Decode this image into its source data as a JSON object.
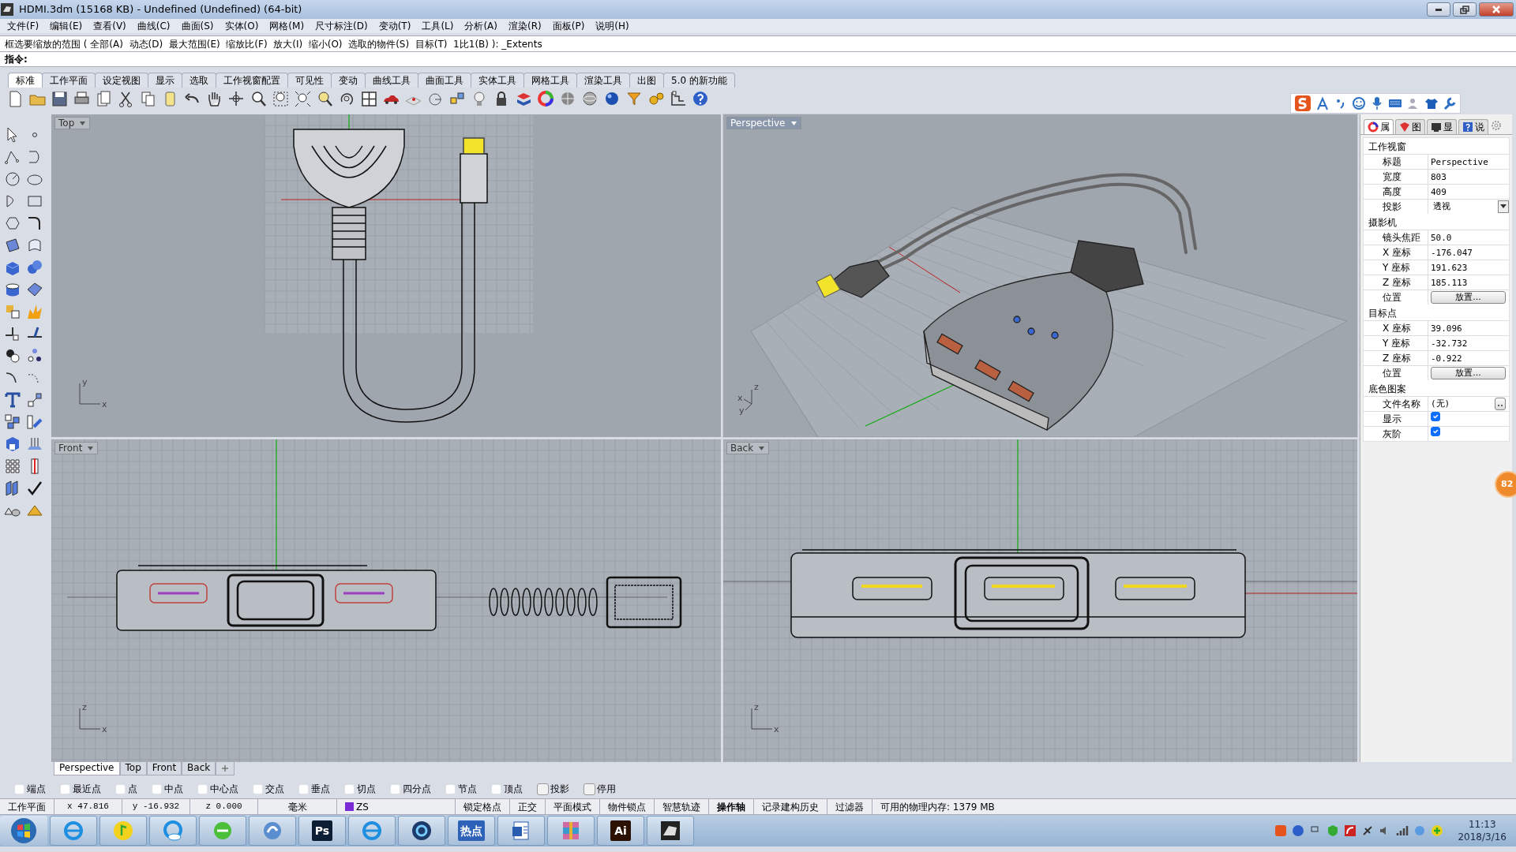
{
  "window": {
    "title": "HDMI.3dm (15168 KB) - Undefined (Undefined) (64-bit)"
  },
  "menu": [
    "文件(F)",
    "编辑(E)",
    "查看(V)",
    "曲线(C)",
    "曲面(S)",
    "实体(O)",
    "网格(M)",
    "尺寸标注(D)",
    "变动(T)",
    "工具(L)",
    "分析(A)",
    "渲染(R)",
    "面板(P)",
    "说明(H)"
  ],
  "command_history": "框选要缩放的范围 ( 全部(A)  动态(D)  最大范围(E)  缩放比(F)  放大(I)  缩小(O)  选取的物件(S)  目标(T)  1比1(B) ): _Extents",
  "command_prompt": "指令:",
  "toolbar_tabs": [
    {
      "label": "标准",
      "selected": true
    },
    {
      "label": "工作平面",
      "selected": false
    },
    {
      "label": "设定视图",
      "selected": false
    },
    {
      "label": "显示",
      "selected": false
    },
    {
      "label": "选取",
      "selected": false
    },
    {
      "label": "工作视窗配置",
      "selected": false
    },
    {
      "label": "可见性",
      "selected": false
    },
    {
      "label": "变动",
      "selected": false
    },
    {
      "label": "曲线工具",
      "selected": false
    },
    {
      "label": "曲面工具",
      "selected": false
    },
    {
      "label": "实体工具",
      "selected": false
    },
    {
      "label": "网格工具",
      "selected": false
    },
    {
      "label": "渲染工具",
      "selected": false
    },
    {
      "label": "出图",
      "selected": false
    },
    {
      "label": "5.0 的新功能",
      "selected": false
    }
  ],
  "viewports": [
    {
      "title": "Top",
      "active": false,
      "axis_labels": [
        "y",
        "x"
      ]
    },
    {
      "title": "Perspective",
      "active": true,
      "axis_labels": [
        "z",
        "x",
        "y"
      ]
    },
    {
      "title": "Front",
      "active": false,
      "axis_labels": [
        "z",
        "x"
      ]
    },
    {
      "title": "Back",
      "active": false,
      "axis_labels": [
        "z",
        "x"
      ]
    }
  ],
  "viewport_tabs": [
    {
      "label": "Perspective",
      "selected": true
    },
    {
      "label": "Top",
      "selected": false
    },
    {
      "label": "Front",
      "selected": false
    },
    {
      "label": "Back",
      "selected": false
    }
  ],
  "osnaps": [
    {
      "label": "端点",
      "kind": "checkbox",
      "checked": false
    },
    {
      "label": "最近点",
      "kind": "checkbox",
      "checked": false
    },
    {
      "label": "点",
      "kind": "checkbox",
      "checked": false
    },
    {
      "label": "中点",
      "kind": "checkbox",
      "checked": false
    },
    {
      "label": "中心点",
      "kind": "checkbox",
      "checked": false
    },
    {
      "label": "交点",
      "kind": "checkbox",
      "checked": false
    },
    {
      "label": "垂点",
      "kind": "checkbox",
      "checked": false
    },
    {
      "label": "切点",
      "kind": "checkbox",
      "checked": false
    },
    {
      "label": "四分点",
      "kind": "checkbox",
      "checked": false
    },
    {
      "label": "节点",
      "kind": "checkbox",
      "checked": false
    },
    {
      "label": "顶点",
      "kind": "checkbox",
      "checked": false
    },
    {
      "label": "投影",
      "kind": "toggle",
      "checked": false
    },
    {
      "label": "停用",
      "kind": "toggle",
      "checked": false
    }
  ],
  "status_bar": [
    {
      "text": "工作平面",
      "kind": "label"
    },
    {
      "text": "x 47.816",
      "kind": "coord"
    },
    {
      "text": "y -16.932",
      "kind": "coord"
    },
    {
      "text": "z 0.000",
      "kind": "coord"
    },
    {
      "text": "毫米",
      "kind": "label"
    },
    {
      "text": "ZS",
      "kind": "layer",
      "color": "#7a2bd6"
    },
    {
      "text": "锁定格点",
      "kind": "toggle",
      "on": false
    },
    {
      "text": "正交",
      "kind": "toggle",
      "on": false
    },
    {
      "text": "平面模式",
      "kind": "toggle",
      "on": false
    },
    {
      "text": "物件锁点",
      "kind": "toggle",
      "on": false
    },
    {
      "text": "智慧轨迹",
      "kind": "toggle",
      "on": false
    },
    {
      "text": "操作轴",
      "kind": "toggle",
      "on": true
    },
    {
      "text": "记录建构历史",
      "kind": "toggle",
      "on": false
    },
    {
      "text": "过滤器",
      "kind": "toggle",
      "on": false
    },
    {
      "text": "可用的物理内存: 1379 MB",
      "kind": "info"
    }
  ],
  "properties": {
    "tabs": [
      {
        "label": "属",
        "selected": true
      },
      {
        "label": "图",
        "selected": false
      },
      {
        "label": "显",
        "selected": false
      },
      {
        "label": "说",
        "selected": false
      }
    ],
    "sections": [
      {
        "title": "工作视窗",
        "rows": [
          {
            "label": "标题",
            "value": "Perspective",
            "kind": "text"
          },
          {
            "label": "宽度",
            "value": "803",
            "kind": "text"
          },
          {
            "label": "高度",
            "value": "409",
            "kind": "text"
          },
          {
            "label": "投影",
            "value": "透视",
            "kind": "select"
          }
        ]
      },
      {
        "title": "摄影机",
        "rows": [
          {
            "label": "镜头焦距",
            "value": "50.0",
            "kind": "text"
          },
          {
            "label": "X 座标",
            "value": "-176.047",
            "kind": "text"
          },
          {
            "label": "Y 座标",
            "value": "191.623",
            "kind": "text"
          },
          {
            "label": "Z 座标",
            "value": "185.113",
            "kind": "text"
          },
          {
            "label": "位置",
            "value": "放置...",
            "kind": "button"
          }
        ]
      },
      {
        "title": "目标点",
        "rows": [
          {
            "label": "X 座标",
            "value": "39.096",
            "kind": "text"
          },
          {
            "label": "Y 座标",
            "value": "-32.732",
            "kind": "text"
          },
          {
            "label": "Z 座标",
            "value": "-0.922",
            "kind": "text"
          },
          {
            "label": "位置",
            "value": "放置...",
            "kind": "button"
          }
        ]
      },
      {
        "title": "底色图案",
        "rows": [
          {
            "label": "文件名称",
            "value": "(无)",
            "kind": "file"
          },
          {
            "label": "显示",
            "kind": "checkbox",
            "checked": true
          },
          {
            "label": "灰阶",
            "kind": "checkbox",
            "checked": true
          }
        ]
      }
    ]
  },
  "float_badge": "82",
  "taskbar": {
    "apps": [
      {
        "kind": "browser-e"
      },
      {
        "kind": "music"
      },
      {
        "kind": "cloud"
      },
      {
        "kind": "browser-green"
      },
      {
        "kind": "swirl"
      },
      {
        "kind": "text",
        "label": "Ps",
        "color": "#0b1e33"
      },
      {
        "kind": "browser-e"
      },
      {
        "kind": "aperture"
      },
      {
        "kind": "text",
        "label": "热点",
        "color": "#2d62b8"
      },
      {
        "kind": "doc"
      },
      {
        "kind": "archive"
      },
      {
        "kind": "text",
        "label": "Ai",
        "color": "#2b1200"
      },
      {
        "kind": "rhino"
      }
    ],
    "time": "11:13",
    "date": "2018/3/16"
  }
}
